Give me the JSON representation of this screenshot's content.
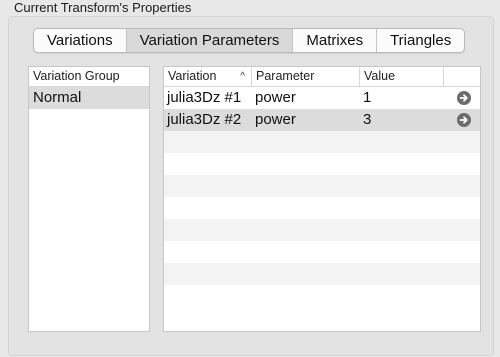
{
  "panel": {
    "title": "Current Transform's Properties"
  },
  "tabs": [
    {
      "label": "Variations",
      "selected": false
    },
    {
      "label": "Variation Parameters",
      "selected": true
    },
    {
      "label": "Matrixes",
      "selected": false
    },
    {
      "label": "Triangles",
      "selected": false
    }
  ],
  "group_list": {
    "header": "Variation Group",
    "items": [
      {
        "label": "Normal",
        "selected": true
      }
    ]
  },
  "param_table": {
    "columns": [
      "Variation",
      "Parameter",
      "Value",
      ""
    ],
    "sort_indicator": "^",
    "rows": [
      {
        "variation": "julia3Dz #1",
        "parameter": "power",
        "value": "1",
        "selected": false,
        "action_icon": "arrow-right-circle-icon"
      },
      {
        "variation": "julia3Dz #2",
        "parameter": "power",
        "value": "3",
        "selected": true,
        "action_icon": "arrow-right-circle-icon"
      }
    ],
    "empty_rows": 8
  },
  "colors": {
    "background": "#e8e8e8",
    "selected_row": "#dcdcdc",
    "alt_row": "#f3f3f3",
    "icon": "#6b6b6b"
  }
}
